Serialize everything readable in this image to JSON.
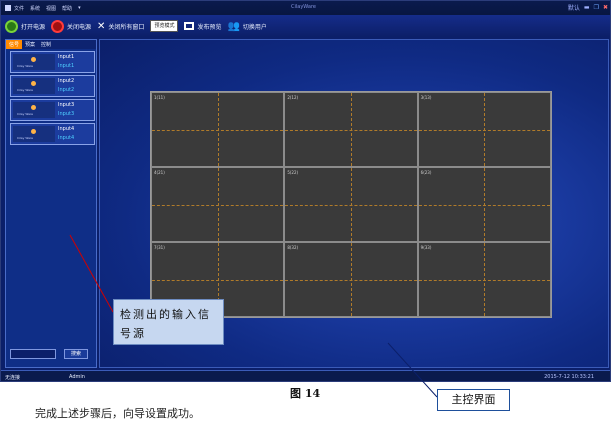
{
  "window": {
    "title": "CilayWare",
    "menu": [
      "文件",
      "系统",
      "视图",
      "帮助"
    ],
    "menu_more": "▾"
  },
  "window_controls": {
    "skin": "默认",
    "minimize": "▬",
    "maximize": "❐",
    "close": "✖"
  },
  "toolbar": {
    "power_on": "打开电源",
    "power_off": "关闭电源",
    "close_all": "关闭所有窗口",
    "mode": "预览模式",
    "publish_preview": "发布预览",
    "switch_user": "切换用户"
  },
  "sidebar": {
    "tabs": [
      "信号",
      "预案",
      "控制"
    ],
    "sources": [
      {
        "name": "Input1",
        "sub": "Input1"
      },
      {
        "name": "Input2",
        "sub": "Input2"
      },
      {
        "name": "Input3",
        "sub": "Input3"
      },
      {
        "name": "Input4",
        "sub": "Input4"
      }
    ],
    "thumb_caption": "Cilay Ware",
    "search_button": "搜索"
  },
  "wall": {
    "cells": [
      "1(11)",
      "2(12)",
      "3(13)",
      "4(21)",
      "5(22)",
      "6(23)",
      "7(31)",
      "8(32)",
      "9(33)"
    ]
  },
  "status": {
    "connection": "无连接",
    "user": "Admin",
    "datetime": "2015-7-12 10:33:21"
  },
  "annotations": {
    "detected_sources": "检测出的输入信号源",
    "main_interface": "主控界面"
  },
  "figure": {
    "caption": "图 14"
  },
  "body": {
    "text": "完成上述步骤后，向导设置成功。"
  },
  "colors": {
    "accent": "#ff8a00",
    "background": "#0b1f6a",
    "wall": "#3a3a3a",
    "grid_dash": "#b07b2a"
  }
}
